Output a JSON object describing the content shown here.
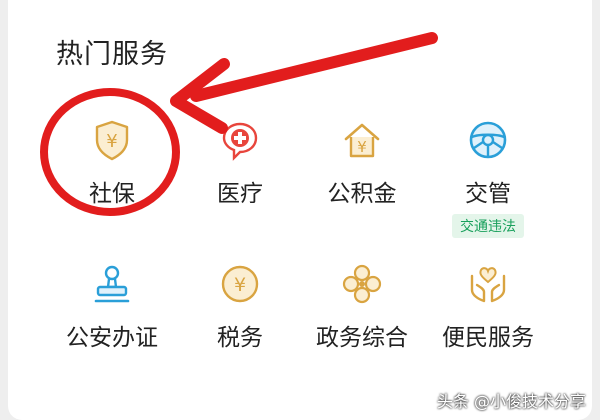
{
  "section": {
    "title": "热门服务"
  },
  "services": [
    {
      "label": "社保",
      "icon": "shield-yuan-icon"
    },
    {
      "label": "医疗",
      "icon": "medical-cross-icon"
    },
    {
      "label": "公积金",
      "icon": "house-yuan-icon"
    },
    {
      "label": "交管",
      "icon": "steering-wheel-icon",
      "tag": "交通违法"
    },
    {
      "label": "公安办证",
      "icon": "stamp-icon"
    },
    {
      "label": "税务",
      "icon": "coin-yuan-icon"
    },
    {
      "label": "政务综合",
      "icon": "clover-icon"
    },
    {
      "label": "便民服务",
      "icon": "hands-heart-icon"
    }
  ],
  "watermark": {
    "text": "头条 @小俊技术分享"
  },
  "colors": {
    "gold": "#d9a441",
    "red": "#e8453c",
    "blue": "#2a9fd8",
    "green": "#19a05c",
    "annotation": "#e21d1d"
  }
}
